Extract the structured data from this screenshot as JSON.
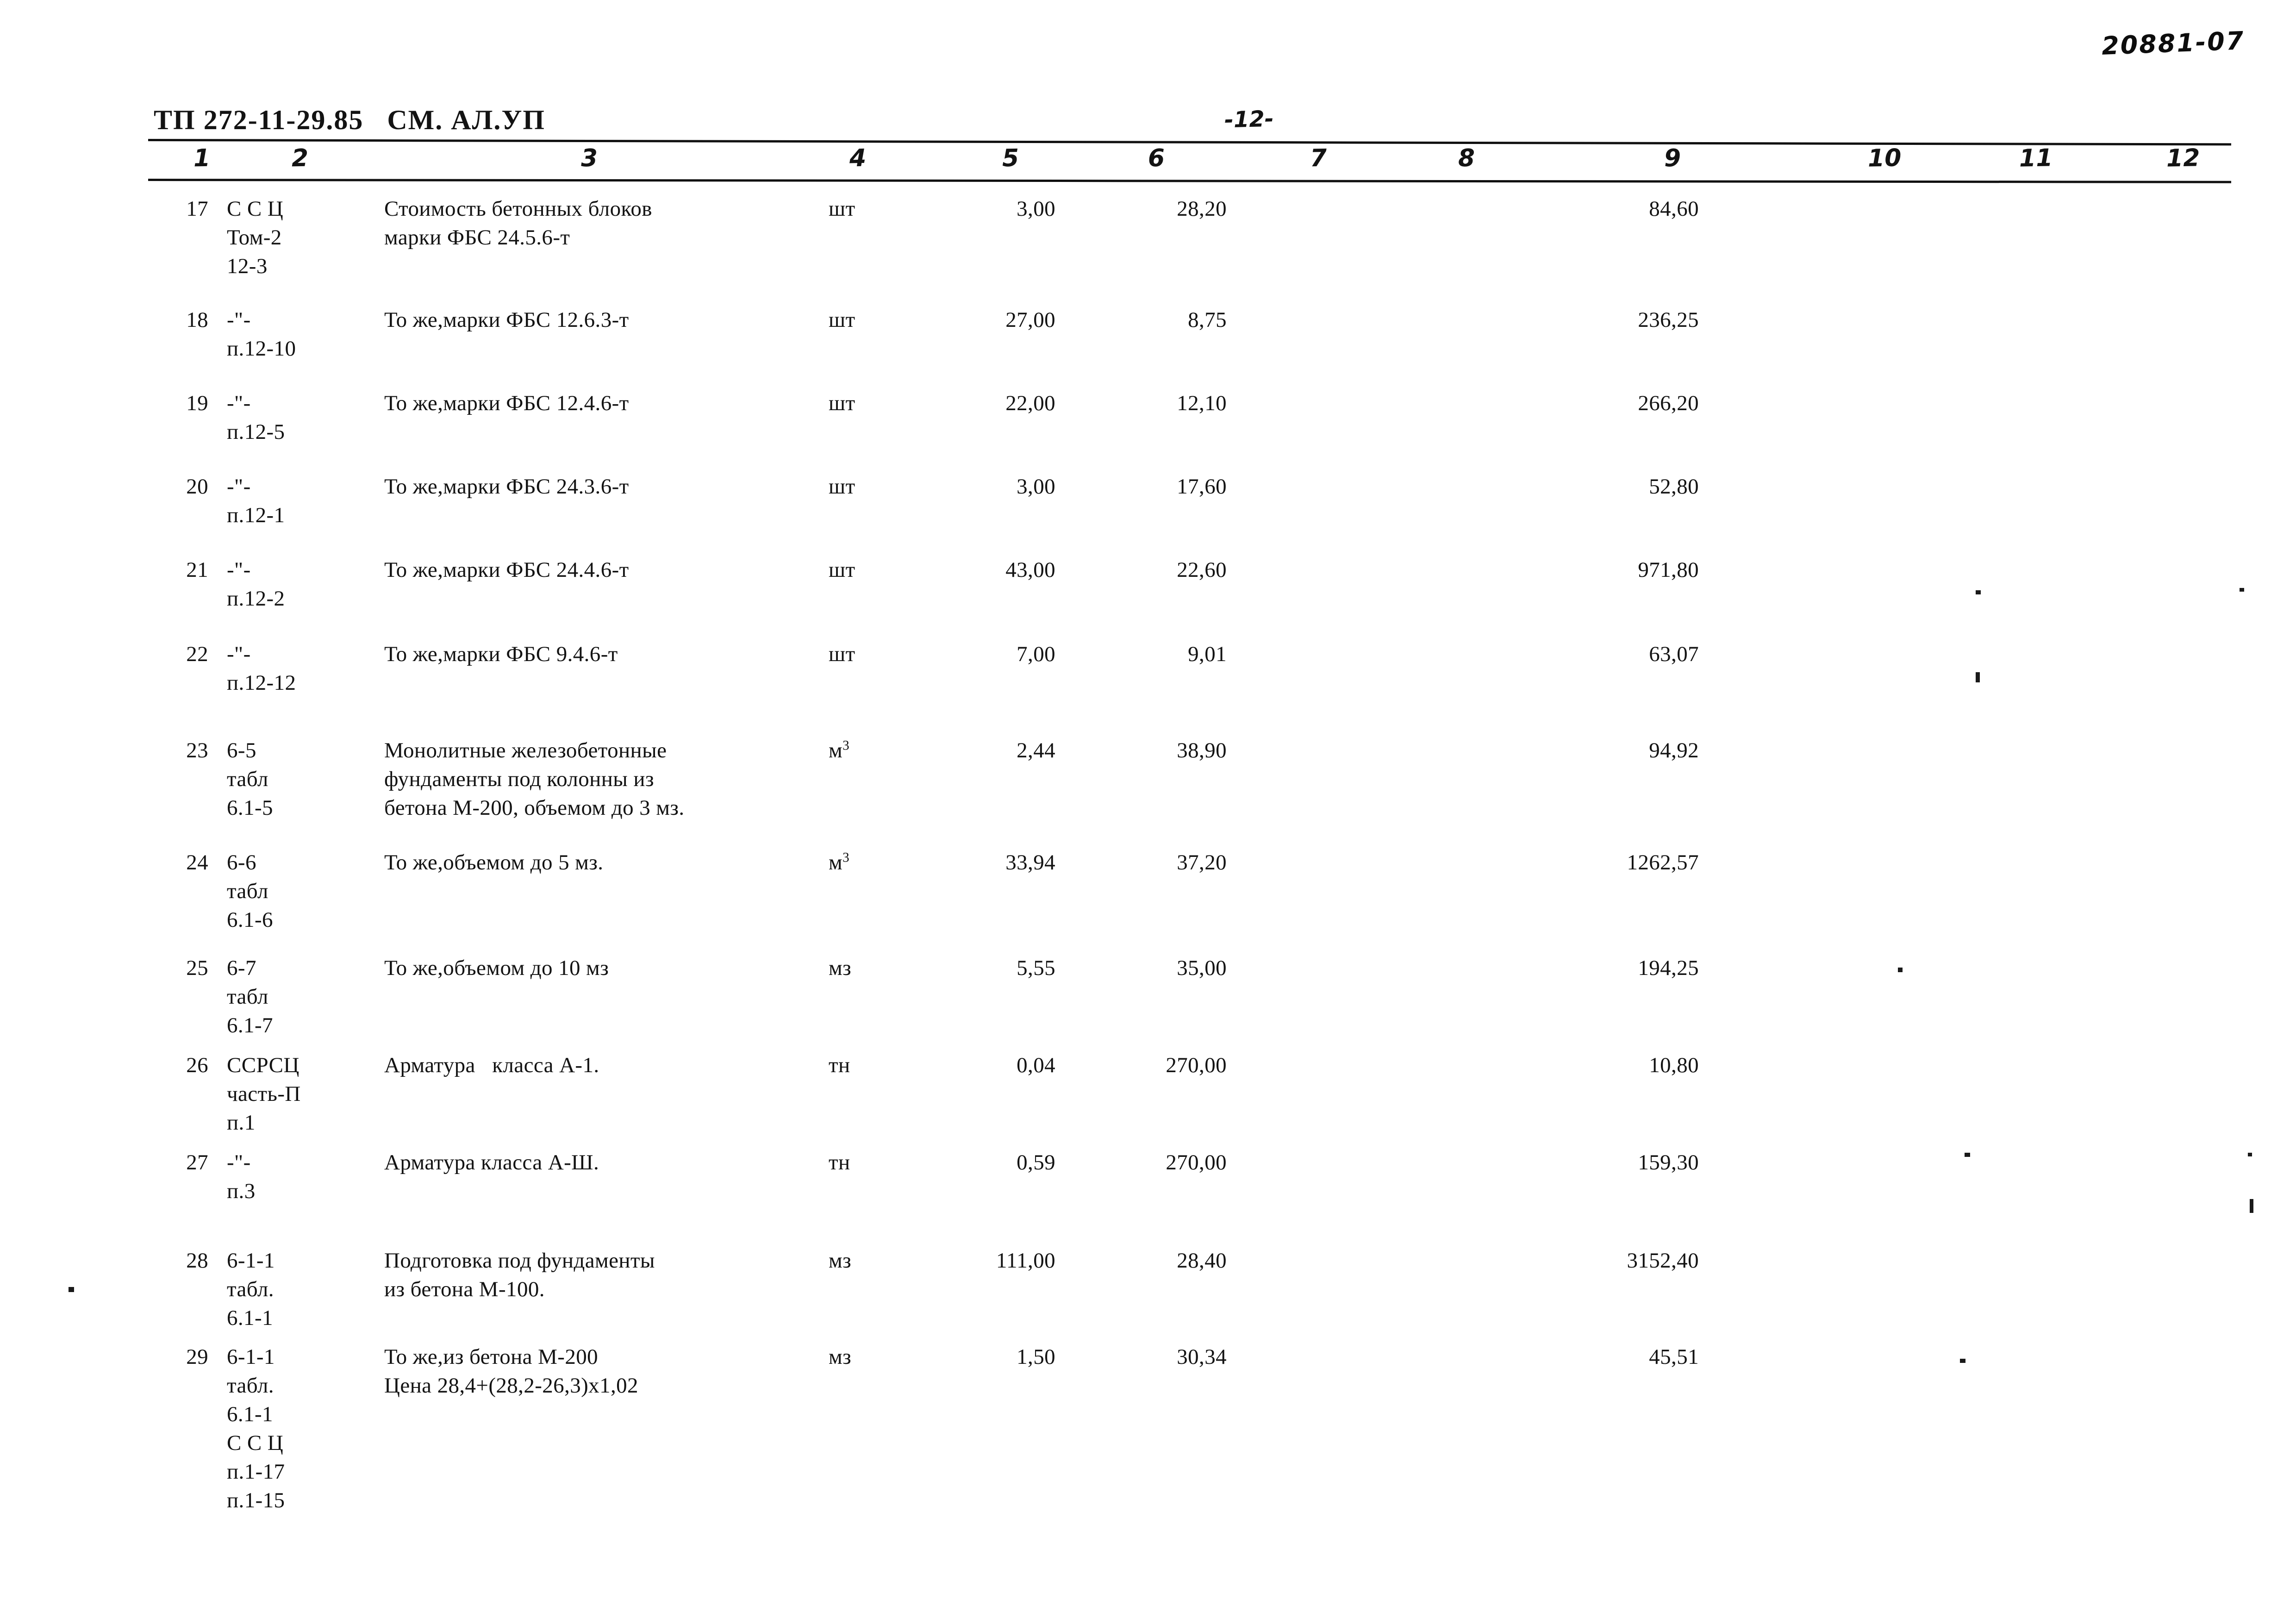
{
  "document": {
    "doc_id": "20881-07",
    "sheet_code": "ТП 272-11-29.85   СМ. АЛ.УП",
    "page_number": "-12-"
  },
  "table": {
    "column_numbers": [
      "1",
      "2",
      "3",
      "4",
      "5",
      "6",
      "7",
      "8",
      "9",
      "10",
      "11",
      "12"
    ],
    "rows": [
      {
        "no": "17",
        "code_lines": [
          "С С Ц",
          "Том-2",
          "12-3"
        ],
        "desc_lines": [
          "Стоимость бетонных блоков",
          "марки ФБС 24.5.6-т"
        ],
        "unit": "шт",
        "qty": "3,00",
        "price": "28,20",
        "total": "84,60"
      },
      {
        "no": "18",
        "code_lines": [
          "-\"-",
          "п.12-10"
        ],
        "desc_lines": [
          "То же,марки ФБС 12.6.3-т"
        ],
        "unit": "шт",
        "qty": "27,00",
        "price": "8,75",
        "total": "236,25"
      },
      {
        "no": "19",
        "code_lines": [
          "-\"-",
          "п.12-5"
        ],
        "desc_lines": [
          "То же,марки ФБС 12.4.6-т"
        ],
        "unit": "шт",
        "qty": "22,00",
        "price": "12,10",
        "total": "266,20"
      },
      {
        "no": "20",
        "code_lines": [
          "-\"-",
          "п.12-1"
        ],
        "desc_lines": [
          "То же,марки ФБС 24.3.6-т"
        ],
        "unit": "шт",
        "qty": "3,00",
        "price": "17,60",
        "total": "52,80"
      },
      {
        "no": "21",
        "code_lines": [
          "-\"-",
          "п.12-2"
        ],
        "desc_lines": [
          "То же,марки ФБС 24.4.6-т"
        ],
        "unit": "шт",
        "qty": "43,00",
        "price": "22,60",
        "total": "971,80"
      },
      {
        "no": "22",
        "code_lines": [
          "-\"-",
          "п.12-12"
        ],
        "desc_lines": [
          "То же,марки ФБС 9.4.6-т"
        ],
        "unit": "шт",
        "qty": "7,00",
        "price": "9,01",
        "total": "63,07"
      },
      {
        "no": "23",
        "code_lines": [
          "6-5",
          "табл",
          "6.1-5"
        ],
        "desc_lines": [
          "Монолитные железобетонные",
          "фундаменты под колонны из",
          "бетона М-200, объемом до 3 мз."
        ],
        "unit": "м3",
        "unit_sup": "3",
        "qty": "2,44",
        "price": "38,90",
        "total": "94,92"
      },
      {
        "no": "24",
        "code_lines": [
          "6-6",
          "табл",
          "6.1-6"
        ],
        "desc_lines": [
          "То же,объемом до 5 мз."
        ],
        "unit": "м3",
        "unit_sup": "3",
        "qty": "33,94",
        "price": "37,20",
        "total": "1262,57"
      },
      {
        "no": "25",
        "code_lines": [
          "6-7",
          "табл",
          "6.1-7"
        ],
        "desc_lines": [
          "То же,объемом до 10 мз"
        ],
        "unit": "мз",
        "qty": "5,55",
        "price": "35,00",
        "total": "194,25"
      },
      {
        "no": "26",
        "code_lines": [
          "ССРСЦ",
          "часть-П",
          "п.1"
        ],
        "desc_lines": [
          "Арматура   класса А-1."
        ],
        "unit": "тн",
        "qty": "0,04",
        "price": "270,00",
        "total": "10,80"
      },
      {
        "no": "27",
        "code_lines": [
          "-\"-",
          "п.3"
        ],
        "desc_lines": [
          "Арматура класса А-Ш."
        ],
        "unit": "тн",
        "qty": "0,59",
        "price": "270,00",
        "total": "159,30"
      },
      {
        "no": "28",
        "code_lines": [
          "6-1-1",
          "табл.",
          "6.1-1"
        ],
        "desc_lines": [
          "Подготовка под фундаменты",
          "из бетона М-100."
        ],
        "unit": "мз",
        "qty": "111,00",
        "price": "28,40",
        "total": "3152,40"
      },
      {
        "no": "29",
        "code_lines": [
          "6-1-1",
          "табл.",
          "6.1-1",
          "С С Ц",
          "п.1-17",
          "п.1-15"
        ],
        "desc_lines": [
          "То же,из бетона М-200",
          "Цена 28,4+(28,2-26,3)х1,02"
        ],
        "unit": "мз",
        "qty": "1,50",
        "price": "30,34",
        "total": "45,51"
      }
    ]
  },
  "layout": {
    "col_x": {
      "no": 330,
      "code": 490,
      "desc": 830,
      "unit": 1790,
      "qty": 1980,
      "price": 2350,
      "total": 3250
    },
    "colnum_x": [
      418,
      630,
      1255,
      1835,
      2165,
      2480,
      2830,
      3150,
      3595,
      4035,
      4362,
      4680
    ],
    "row_top": [
      420,
      660,
      840,
      1020,
      1200,
      1382,
      1590,
      1832,
      2060,
      2270,
      2480,
      2692,
      2900
    ]
  }
}
